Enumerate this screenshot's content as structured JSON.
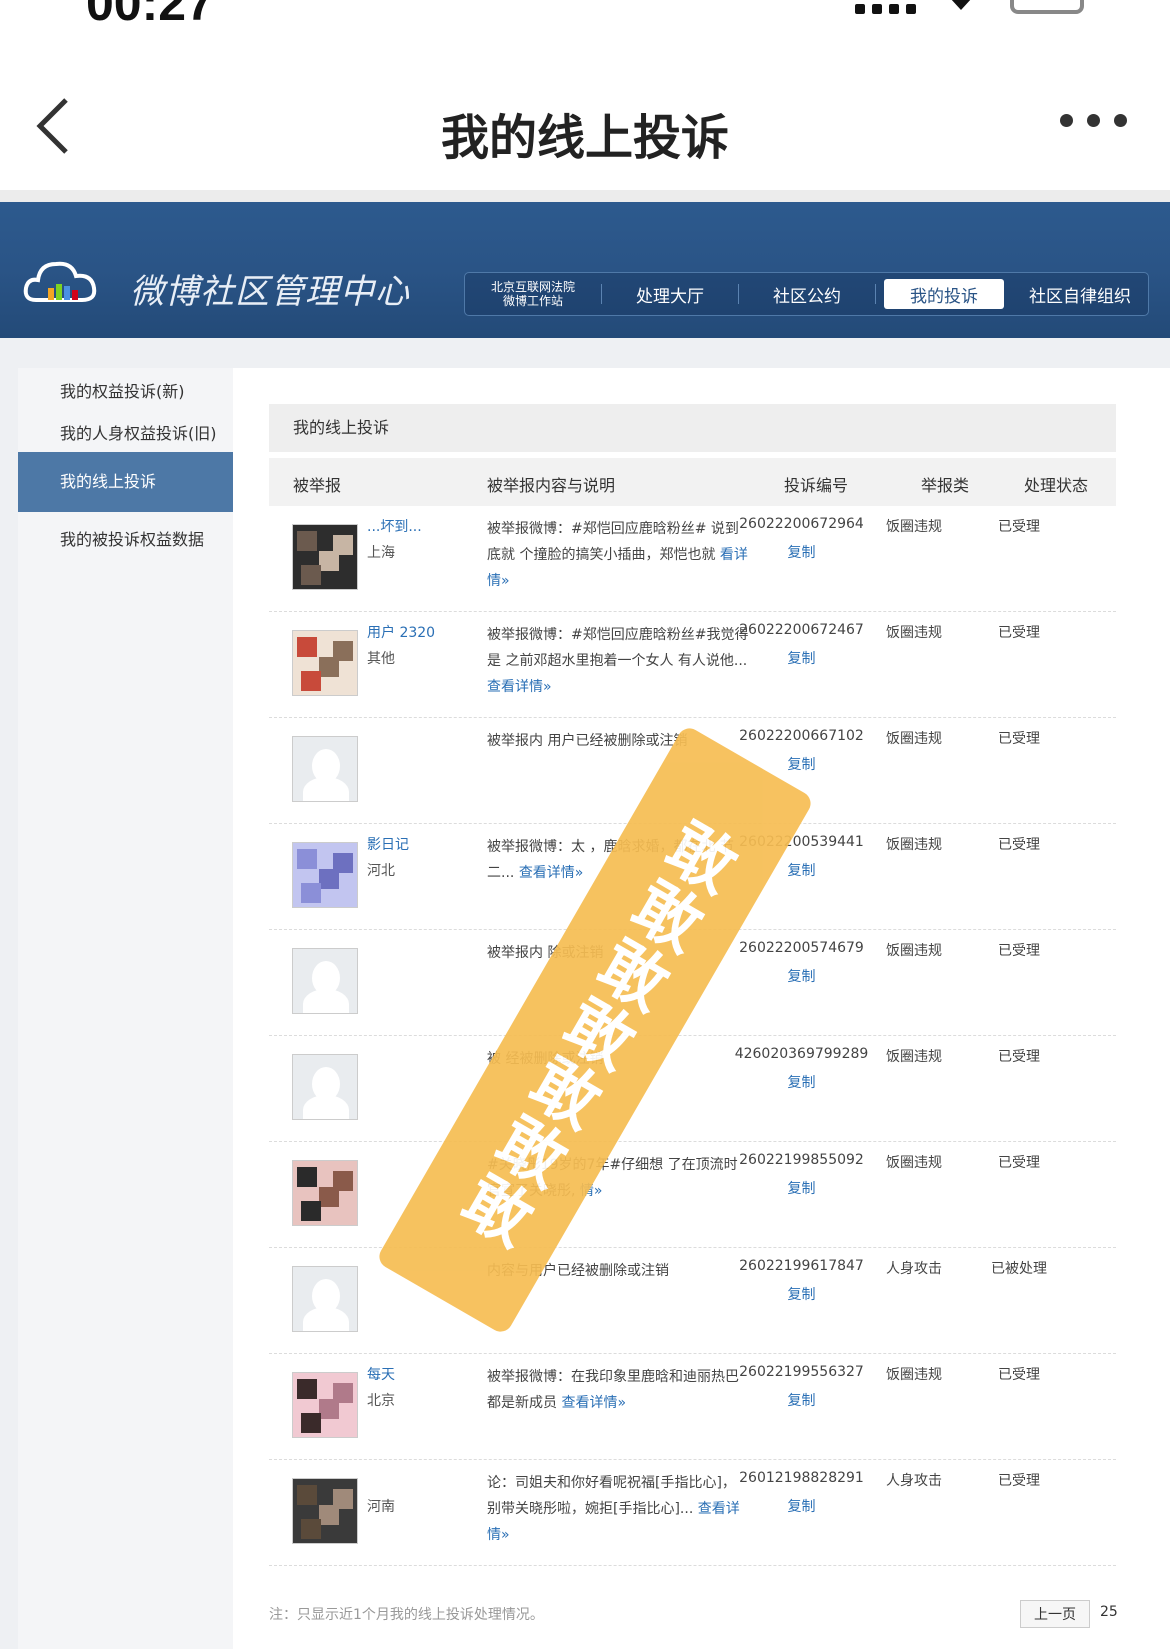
{
  "status_bar": {
    "time": "00:27"
  },
  "appbar": {
    "title": "我的线上投诉"
  },
  "banner": {
    "logo_text": "微博社区管理中心",
    "nav": {
      "court_line1": "北京互联网法院",
      "court_line2": "微博工作站",
      "hall": "处理大厅",
      "convention": "社区公约",
      "my_complaints": "我的投诉",
      "self_org": "社区自律组织"
    }
  },
  "sidebar": {
    "items": [
      {
        "label": "我的权益投诉(新)"
      },
      {
        "label": "我的人身权益投诉(旧)"
      },
      {
        "label": "我的线上投诉"
      },
      {
        "label": "我的被投诉权益数据"
      }
    ]
  },
  "main": {
    "section_title": "我的线上投诉",
    "columns": {
      "reported": "被举报",
      "content": "被举报内容与说明",
      "number": "投诉编号",
      "category": "举报类",
      "status": "处理状态"
    },
    "copy_label": "复制",
    "rows": [
      {
        "user": "...坏到...",
        "location": "上海",
        "desc": "被举报微博：#郑恺回应鹿晗粉丝# 说到底就 个撞脸的搞笑小插曲，郑恺也就",
        "more": "看详情»",
        "number": "26022200672964",
        "category": "饭圈违规",
        "status": "已受理"
      },
      {
        "user": "用户 2320",
        "location": "其他",
        "desc": "被举报微博：#郑恺回应鹿晗粉丝#我觉得是 之前邓超水里抱着一个女人 有人说他...",
        "more": "查看详情»",
        "number": "26022200672467",
        "category": "饭圈违规",
        "status": "已受理"
      },
      {
        "user": "",
        "location": "",
        "desc": "被举报内 用户已经被删除或注销",
        "more": "",
        "number": "26022200667102",
        "category": "饭圈违规",
        "status": "已受理"
      },
      {
        "user": "影日记",
        "location": "河北",
        "desc": "被举报微博：太 ，鹿晗求婚，都在北 节二...",
        "more": "查看详情»",
        "number": "26022200539441",
        "category": "饭圈违规",
        "status": "已受理"
      },
      {
        "user": "",
        "location": "",
        "desc": "被举报内 除或注销",
        "more": "",
        "number": "26022200574679",
        "category": "饭圈违规",
        "status": "已受理"
      },
      {
        "user": "",
        "location": "",
        "desc": "被 经被删除或注销",
        "more": "",
        "number": "426020369799289",
        "category": "饭圈违规",
        "status": "已受理"
      },
      {
        "user": "",
        "location": "",
        "desc": "#关晓彤19岁的7年#仔细想 了在顶流时官宣了关晓彤,",
        "more": "情»",
        "number": "26022199855092",
        "category": "饭圈违规",
        "status": "已受理"
      },
      {
        "user": "",
        "location": "",
        "desc": "内容与用户已经被删除或注销",
        "more": "",
        "number": "26022199617847",
        "category": "人身攻击",
        "status": "已被处理"
      },
      {
        "user": "每天",
        "location": "北京",
        "desc": "被举报微博：在我印象里鹿晗和迪丽热巴都是新成员",
        "more": "查看详情»",
        "number": "26022199556327",
        "category": "饭圈违规",
        "status": "已受理"
      },
      {
        "user": "",
        "location": "河南",
        "desc": "论：司姐夫和你好看呢祝福[手指比心]，别带关晓彤啦，婉拒[手指比心]...",
        "more": "查看详情»",
        "number": "26012198828291",
        "category": "人身攻击",
        "status": "已受理"
      }
    ],
    "footer_note": "注：只显示近1个月我的线上投诉处理情况。",
    "prev": "上一页",
    "page": "25"
  },
  "watermark": "敢敢敢敢敢敢敢",
  "colors": {
    "banner": "#2a5486",
    "link": "#2a6fb5",
    "stamp": "#f6bd52",
    "sidebar_active": "#4d78a6"
  }
}
